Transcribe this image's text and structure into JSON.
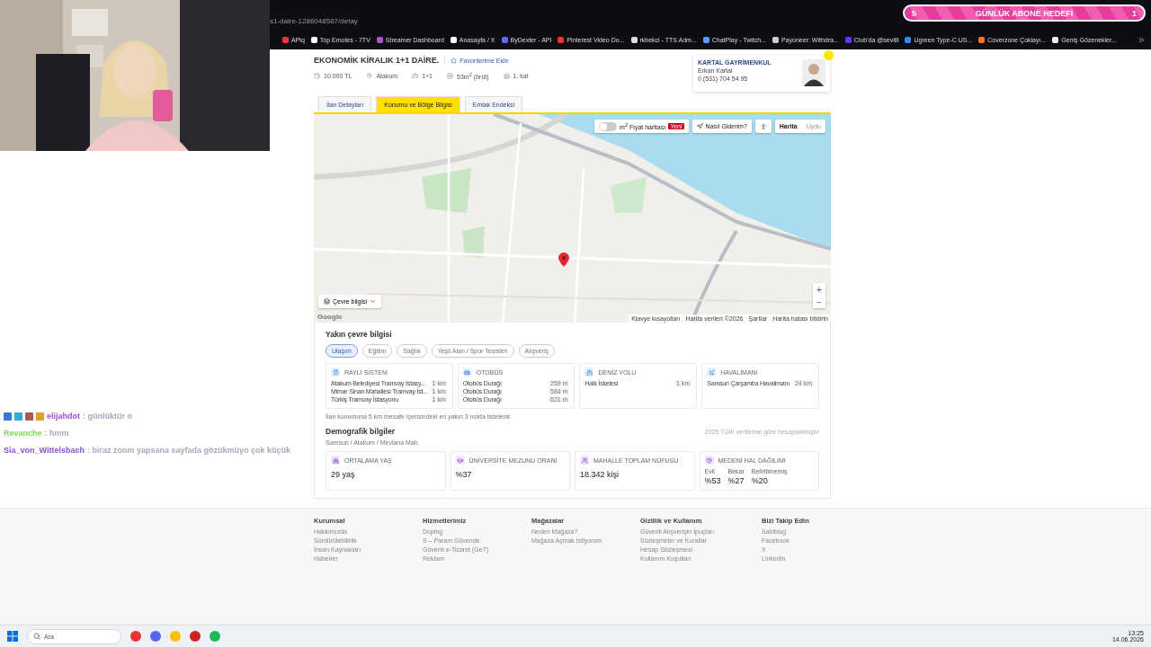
{
  "browser": {
    "url": "s1-daire-1286048567/detay",
    "bookmarks": [
      "APlq",
      "Top Emotes - 7TV",
      "Streamer Dashboard",
      "Anasayfa / X",
      "ByDexter - API",
      "Pinterest Video Do...",
      "rkbekci - TTS Adm...",
      "ChatPlay - Twitch...",
      "Payoneer: Withdra...",
      "Club'da @sevilll",
      "Ugreen Type-C US...",
      "Coverzone Çoklayı...",
      "Geniş Gözenekler..."
    ]
  },
  "goal": {
    "current": "5",
    "label": "GÜNLÜK ABONE HEDEFİ",
    "target": "1"
  },
  "listing": {
    "title": "EKONOMİK KİRALIK 1+1 DAİRE.",
    "favorite": "Favorilerime Ekle",
    "facts": [
      {
        "kind": "price",
        "text": "10.000 TL"
      },
      {
        "kind": "location",
        "text": "Atakum"
      },
      {
        "kind": "rooms",
        "text": "1+1"
      },
      {
        "kind": "area",
        "text": "53m$^{2}$ (brüt)"
      },
      {
        "kind": "floor",
        "text": "1. kat"
      }
    ]
  },
  "agent": {
    "company": "KARTAL GAYRİMENKUL",
    "name": "Erkan Kartal",
    "phone": "0 (531) 704 54 95"
  },
  "tabs": [
    {
      "label": "İlan Detayları",
      "selected": false
    },
    {
      "label": "Konumu ve Bölge Bilgisi",
      "selected": true
    },
    {
      "label": "Emlak Endeksi",
      "selected": false
    }
  ],
  "map": {
    "price_map": {
      "label": "m$^{2}$ Fiyat haritası",
      "badge": "Yeni",
      "on": false
    },
    "directions": "Nasıl Giderim?",
    "types": [
      {
        "label": "Harita",
        "selected": true
      },
      {
        "label": "Uydu",
        "selected": false
      }
    ],
    "zoom_in": "+",
    "zoom_out": "−",
    "surroundings": "Çevre bilgisi",
    "logo": "Google",
    "attribution": [
      "Klavye kısayolları",
      "Harita verileri ©2026",
      "Şartlar",
      "Harita hatası bildirin"
    ]
  },
  "nearby": {
    "title": "Yakın çevre bilgisi",
    "chips": [
      {
        "label": "Ulaşım",
        "selected": true
      },
      {
        "label": "Eğitim",
        "selected": false
      },
      {
        "label": "Sağlık",
        "selected": false
      },
      {
        "label": "Yeşil Alan / Spor Tesisleri",
        "selected": false
      },
      {
        "label": "Alışveriş",
        "selected": false
      }
    ],
    "cards": [
      {
        "kind": "rail",
        "title": "RAYLI SİSTEM",
        "items": [
          {
            "name": "Atakum Belediyesi Tramvay İstasy...",
            "distance": "1 km"
          },
          {
            "name": "Mimar Sinan Mahallesi Tramvay İst...",
            "distance": "1 km"
          },
          {
            "name": "Türkiş Tramvay İstasyonu",
            "distance": "1 km"
          }
        ]
      },
      {
        "kind": "bus",
        "title": "OTOBÜS",
        "items": [
          {
            "name": "Otobüs Durağı",
            "distance": "259 m"
          },
          {
            "name": "Otobüs Durağı",
            "distance": "584 m"
          },
          {
            "name": "Otobüs Durağı",
            "distance": "621 m"
          }
        ]
      },
      {
        "kind": "ship",
        "title": "DENİZ YOLU",
        "items": [
          {
            "name": "Halk İskelesi",
            "distance": "1 km"
          }
        ]
      },
      {
        "kind": "plane",
        "title": "HAVALİMANI",
        "items": [
          {
            "name": "Samsun Çarşamba Havalimanı",
            "distance": "24 km"
          }
        ]
      }
    ],
    "note": "İlan konumuna 5 km mesafe içerisindeki en yakın 3 nokta listelenir."
  },
  "demographics": {
    "title": "Demografik bilgiler",
    "source": "2025 TÜİK verilerine göre hesaplanmıştır",
    "region": "Samsun / Atakum / Mevlana Mah.",
    "cards": [
      {
        "kind": "age",
        "title": "ORTALAMA YAŞ",
        "value": "29 yaş"
      },
      {
        "kind": "education",
        "title": "ÜNİVERSİTE MEZUNU ORANI",
        "value": "%37"
      },
      {
        "kind": "population",
        "title": "MAHALLE TOPLAM NÜFUSU",
        "value": "18.342 kişi"
      },
      {
        "kind": "marital",
        "title": "MEDENİ HAL DAĞILIMI",
        "parts": [
          {
            "label": "Evli",
            "value": "%53"
          },
          {
            "label": "Bekar",
            "value": "%27"
          },
          {
            "label": "Belirtilmemiş",
            "value": "%20"
          }
        ]
      }
    ]
  },
  "footer": [
    {
      "title": "Kurumsal",
      "links": [
        "Hakkımızda",
        "Sürdürülebilirlik",
        "İnsan Kaynakları",
        "Haberler"
      ]
    },
    {
      "title": "Hizmetlerimiz",
      "links": [
        "Doping",
        "S – Param Güvende",
        "Güvenli e-Ticaret (GeT)",
        "Reklam"
      ]
    },
    {
      "title": "Mağazalar",
      "links": [
        "Neden Mağaza?",
        "Mağaza Açmak İstiyorum"
      ]
    },
    {
      "title": "Gizlilik ve Kullanım",
      "links": [
        "Güvenli Alışverişin İpuçları",
        "Sözleşmeler ve Kurallar",
        "Hesap Sözleşmesi",
        "Kullanım Koşulları"
      ]
    },
    {
      "title": "Bizi Takip Edin",
      "links": [
        "Sahiblog",
        "Facebook",
        "X",
        "LinkedIn"
      ]
    }
  ],
  "chat": [
    {
      "user": "elijahdot",
      "color": "#9b4fd6",
      "message": ": günlüktür o"
    },
    {
      "user": "Revanche",
      "color": "#7ed957",
      "message": ": hmm"
    },
    {
      "user": "Sia_von_Wittelsbach",
      "color": "#8a4fd8",
      "message": ": biraz zoom yapsana sayfada gözükmüyo çok küçük"
    }
  ],
  "taskbar": {
    "search": "Ara",
    "time": "13:25",
    "date": "14.06.2026"
  }
}
